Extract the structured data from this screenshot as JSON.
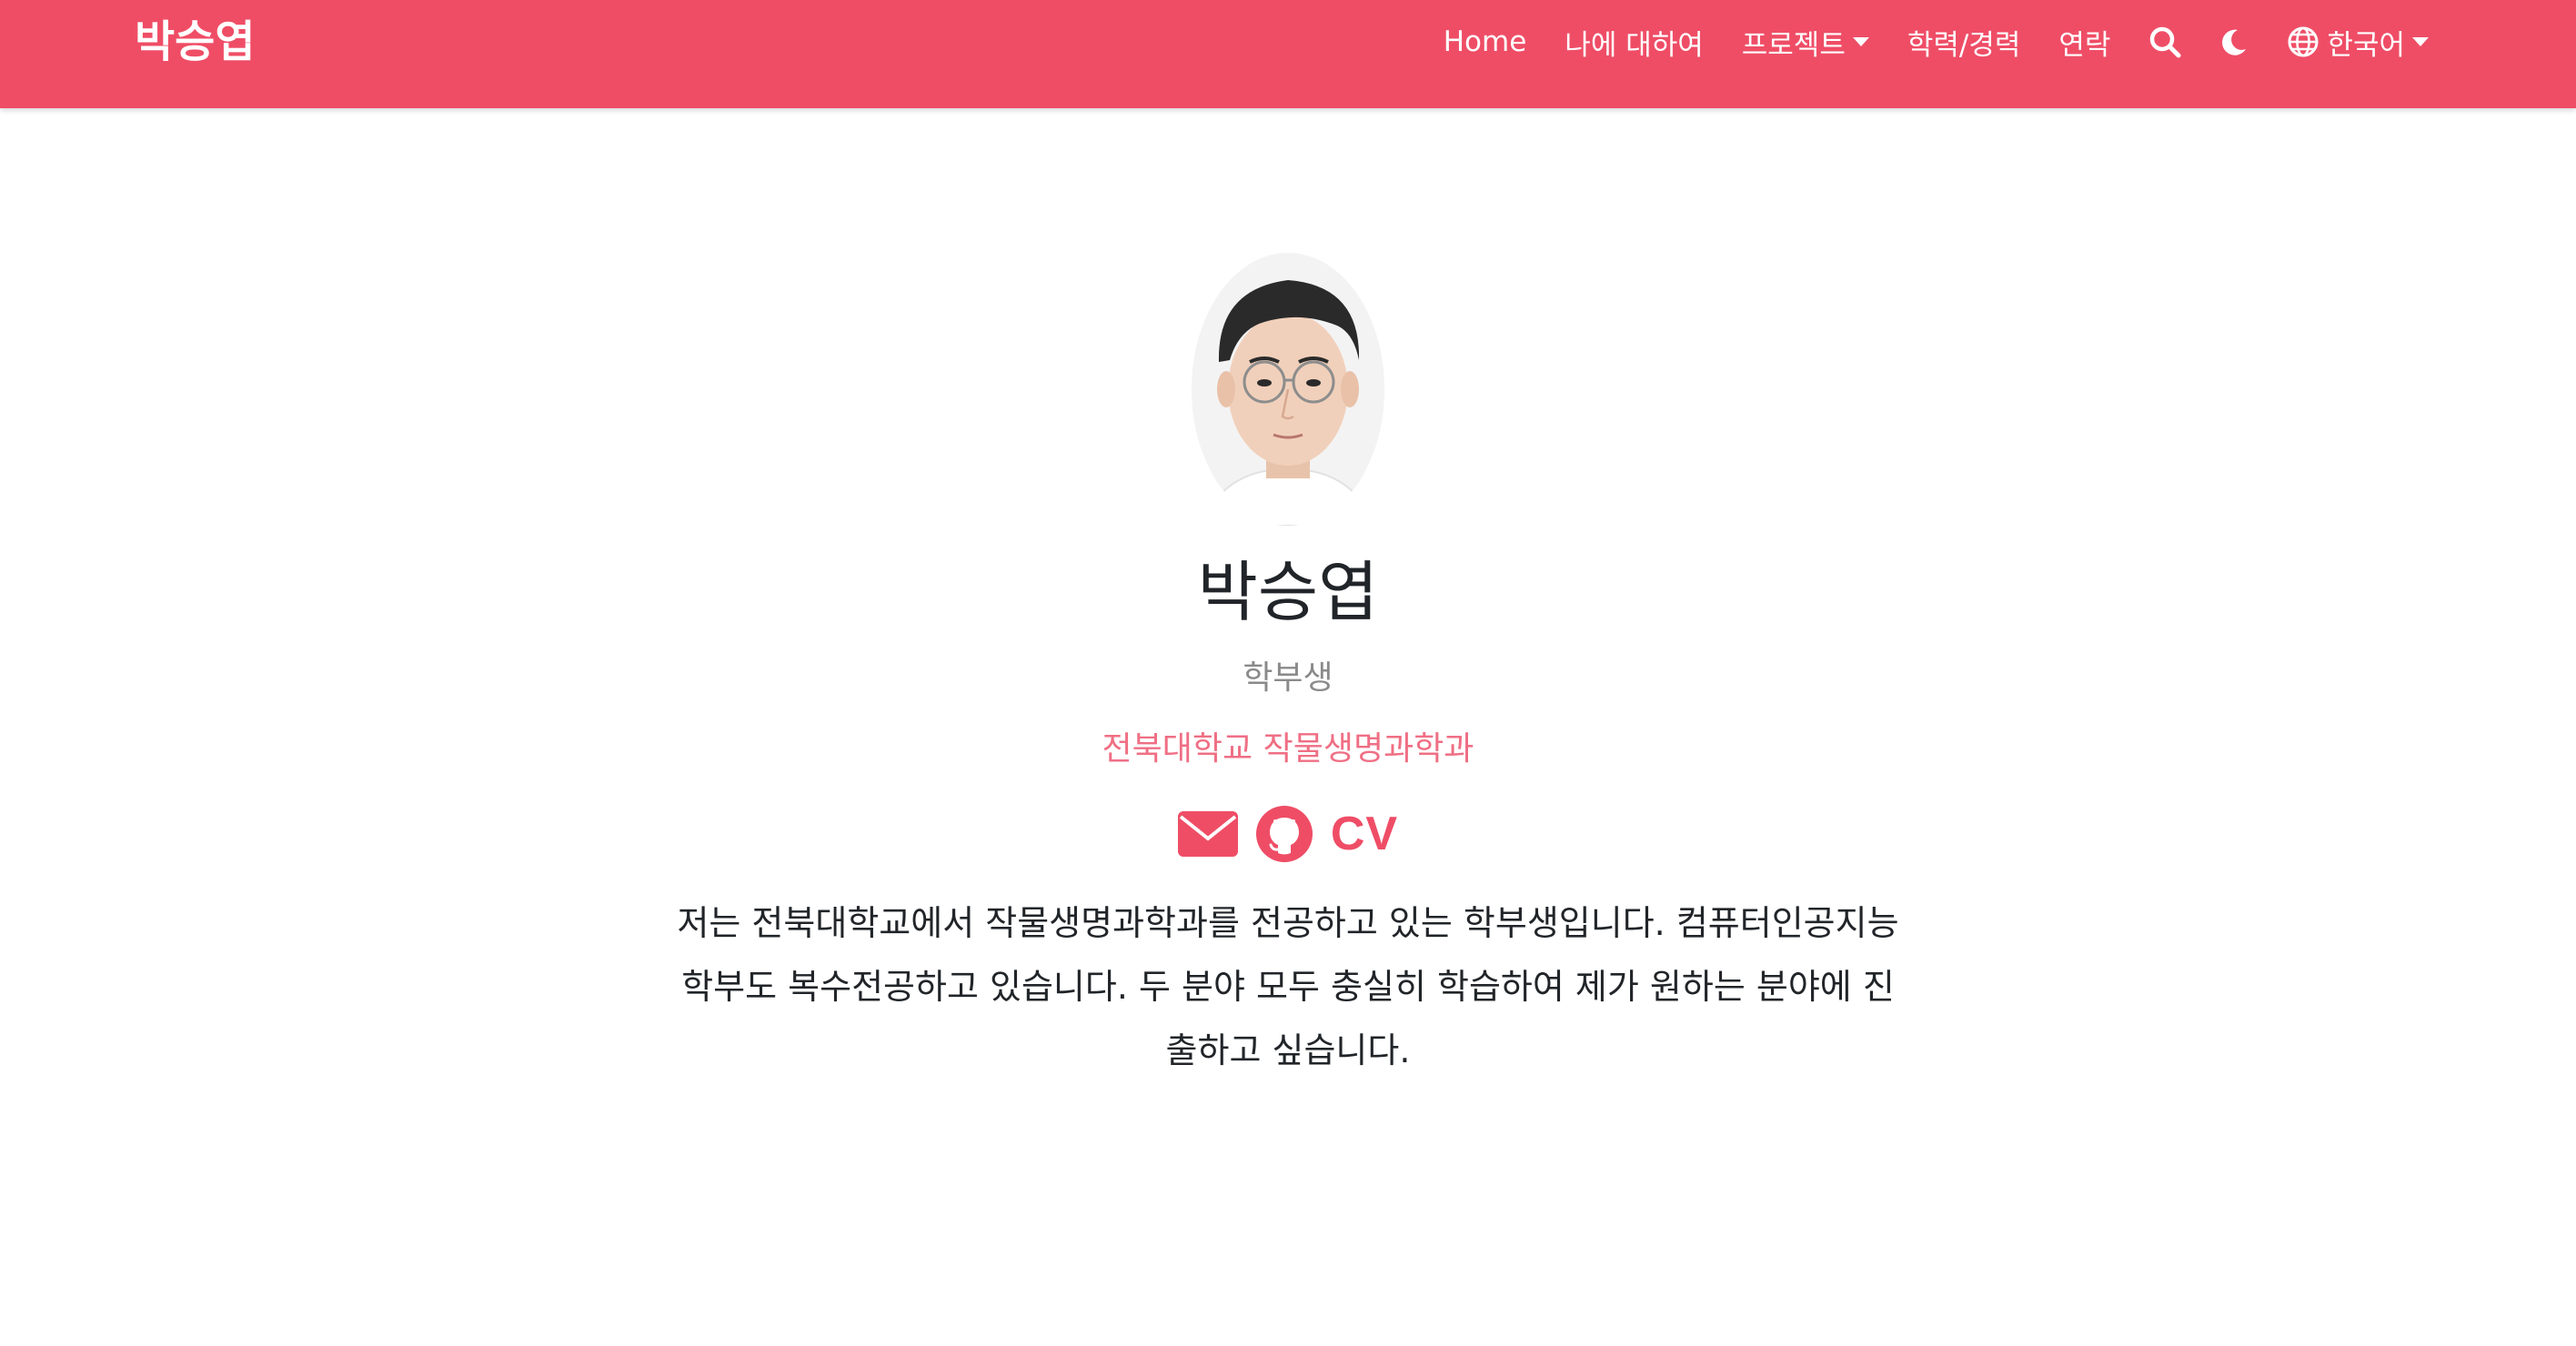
{
  "navbar": {
    "brand": "박승엽",
    "links": [
      "Home",
      "나에 대하여",
      "프로젝트",
      "학력/경력",
      "연락"
    ],
    "language": "한국어",
    "icons": [
      "search-icon",
      "moon-icon",
      "globe-icon"
    ],
    "background": "#ef4d66"
  },
  "profile": {
    "name": "박승엽",
    "role": "학부생",
    "affiliation": "전북대학교 작물생명과학과",
    "social": {
      "icons": [
        "envelope-icon",
        "github-icon"
      ],
      "cv_label": "CV"
    },
    "bio": "저는 전북대학교에서 작물생명과학과를 전공하고 있는 학부생입니다. 컴퓨터인공지능학부도 복수전공하고 있습니다. 두 분야 모두 충실히 학습하여 제가 원하는 분야에 진출하고 싶습니다."
  },
  "colors": {
    "accent": "#ef4d66",
    "affiliation": "#ef6f84",
    "muted": "#8a8a8a"
  }
}
